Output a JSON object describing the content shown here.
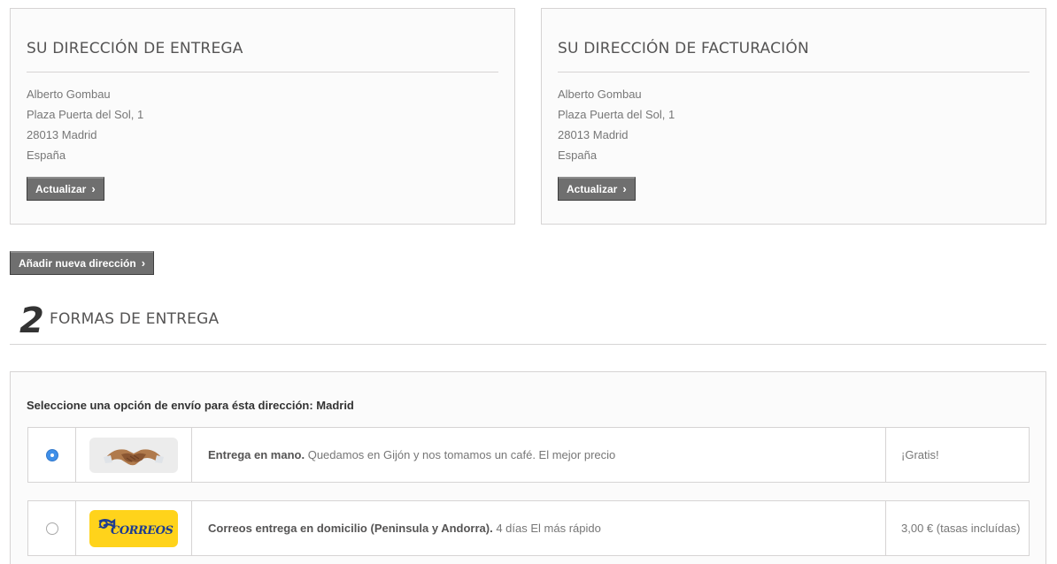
{
  "delivery_address": {
    "title": "SU DIRECCIÓN DE ENTREGA",
    "name": "Alberto Gombau",
    "street": "Plaza Puerta del Sol, 1",
    "city": "28013 Madrid",
    "country": "España",
    "update_label": "Actualizar"
  },
  "billing_address": {
    "title": "SU DIRECCIÓN DE FACTURACIÓN",
    "name": "Alberto Gombau",
    "street": "Plaza Puerta del Sol, 1",
    "city": "28013 Madrid",
    "country": "España",
    "update_label": "Actualizar"
  },
  "add_address_label": "Añadir nueva dirección",
  "step": {
    "number": "2",
    "title": "FORMAS DE ENTREGA"
  },
  "shipping": {
    "intro": "Seleccione una opción de envío para ésta dirección: Madrid",
    "options": [
      {
        "selected": true,
        "logo": "handshake-icon",
        "name": "Entrega en mano.",
        "detail": "Quedamos en Gijón y nos tomamos un café. El mejor precio",
        "price": "¡Gratis!"
      },
      {
        "selected": false,
        "logo": "correos-logo",
        "logo_text": "CORREOS",
        "name": "Correos entrega en domicilio (Peninsula y Andorra).",
        "detail": "4 días El más rápido",
        "price": "3,00 € (tasas incluídas)"
      }
    ]
  },
  "colors": {
    "button_bg": "#6f6f6f",
    "box_bg": "#fbfbfb",
    "border": "#d6d4d4",
    "radio_selected": "#3f8fe8",
    "correos_yellow": "#ffd31b",
    "correos_blue": "#1f3d8f"
  }
}
